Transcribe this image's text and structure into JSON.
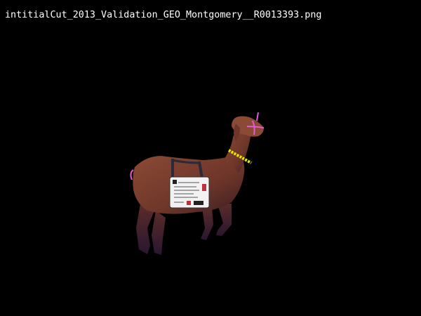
{
  "viewer": {
    "filename": "intitialCut_2013_Validation_GEO_Montgomery__R0013393.png",
    "background_color": "#000000",
    "text_color": "#ffffff"
  },
  "subject": {
    "animal": "goat-image",
    "colors": {
      "coat": "#7a3f2e",
      "coat_shadow": "#3d1f22",
      "halter": "#e55ad0",
      "collar": "#e6e600",
      "tag": "#f2f2f2"
    }
  }
}
